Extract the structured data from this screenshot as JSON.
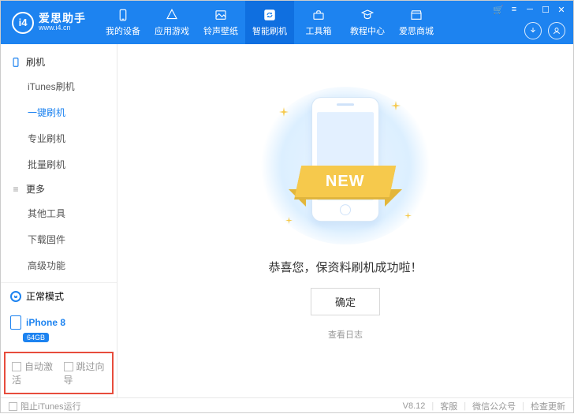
{
  "app": {
    "title": "爱思助手",
    "url": "www.i4.cn",
    "logo_text": "i4"
  },
  "nav": {
    "items": [
      {
        "label": "我的设备"
      },
      {
        "label": "应用游戏"
      },
      {
        "label": "铃声壁纸"
      },
      {
        "label": "智能刷机"
      },
      {
        "label": "工具箱"
      },
      {
        "label": "教程中心"
      },
      {
        "label": "爱思商城"
      }
    ]
  },
  "sidebar": {
    "group1": {
      "title": "刷机",
      "items": [
        "iTunes刷机",
        "一键刷机",
        "专业刷机",
        "批量刷机"
      ]
    },
    "group2": {
      "title": "更多",
      "items": [
        "其他工具",
        "下载固件",
        "高级功能"
      ]
    },
    "status": {
      "mode": "正常模式",
      "device": "iPhone 8",
      "storage": "64GB"
    },
    "checks": {
      "auto_activate": "自动激活",
      "skip_guide": "跳过向导"
    }
  },
  "main": {
    "ribbon": "NEW",
    "success": "恭喜您，保资料刷机成功啦！",
    "ok": "确定",
    "log": "查看日志"
  },
  "footer": {
    "prevent_itunes": "阻止iTunes运行",
    "version": "V8.12",
    "support": "客服",
    "wechat": "微信公众号",
    "update": "检查更新"
  }
}
